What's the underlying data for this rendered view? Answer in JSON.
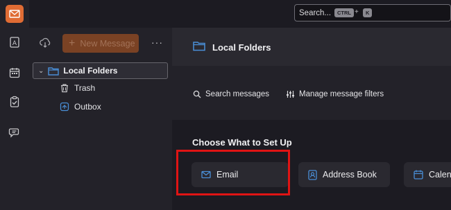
{
  "colors": {
    "accent": "#e06c34",
    "folder_blue": "#4a8fd8",
    "highlight_red": "#e01414"
  },
  "spaces_toolbar": {
    "items": [
      {
        "name": "mail",
        "icon": "envelope-icon"
      },
      {
        "name": "address-book",
        "icon": "address-book-icon"
      },
      {
        "name": "calendar",
        "icon": "calendar-icon"
      },
      {
        "name": "tasks",
        "icon": "tasks-icon"
      },
      {
        "name": "chat",
        "icon": "chat-icon"
      }
    ]
  },
  "search": {
    "placeholder": "Search...",
    "shortcut_key1": "CTRL",
    "shortcut_plus": "+",
    "shortcut_key2": "K"
  },
  "folder_pane": {
    "new_message_label": "New Message",
    "more_label": "···",
    "folders": [
      {
        "label": "Local Folders",
        "icon": "folder-icon",
        "expanded": true,
        "selected": true
      },
      {
        "label": "Trash",
        "icon": "trash-icon"
      },
      {
        "label": "Outbox",
        "icon": "outbox-icon"
      }
    ]
  },
  "main": {
    "title": "Local Folders",
    "actions": {
      "search_messages": "Search messages",
      "manage_filters": "Manage message filters"
    },
    "setup": {
      "title": "Choose What to Set Up",
      "cards": [
        {
          "label": "Email",
          "icon": "envelope-icon"
        },
        {
          "label": "Address Book",
          "icon": "address-book-icon"
        },
        {
          "label": "Calen",
          "icon": "calendar-icon"
        }
      ]
    }
  }
}
